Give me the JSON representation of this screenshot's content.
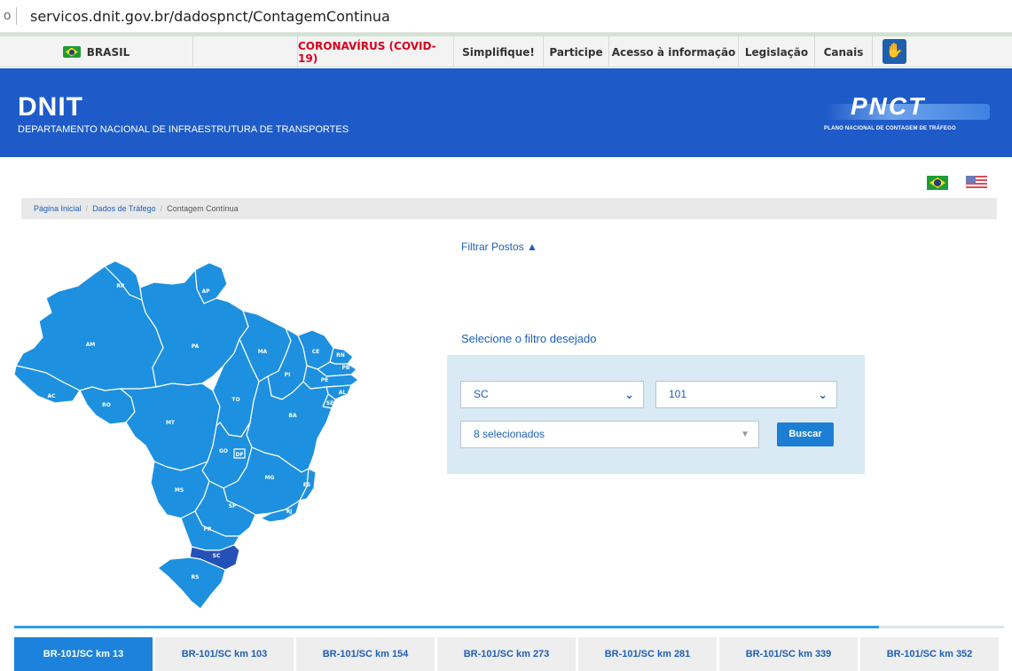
{
  "browser": {
    "fragment": "o",
    "url": "servicos.dnit.gov.br/dadospnct/ContagemContinua"
  },
  "govbar": {
    "brasil": "BRASIL",
    "items": [
      "CORONAVÍRUS (COVID-19)",
      "Simplifique!",
      "Participe",
      "Acesso à informação",
      "Legislação",
      "Canais"
    ],
    "highlight_color": "#d8001b"
  },
  "header": {
    "title": "DNIT",
    "subtitle": "DEPARTAMENTO NACIONAL DE INFRAESTRUTURA DE TRANSPORTES",
    "logo": "PNCT",
    "logo_subtitle": "PLANO NACIONAL DE CONTAGEM DE TRÁFEGO",
    "bg_color": "#1e5bc8"
  },
  "breadcrumb": {
    "home": "Página Inicial",
    "section": "Dados de Tráfego",
    "current": "Contagem Contínua"
  },
  "map": {
    "states": [
      "RR",
      "AP",
      "AM",
      "PA",
      "MA",
      "CE",
      "RN",
      "PB",
      "PE",
      "AL",
      "SE",
      "PI",
      "AC",
      "RO",
      "TO",
      "BA",
      "MT",
      "DF",
      "GO",
      "MG",
      "ES",
      "MS",
      "SP",
      "RJ",
      "PR",
      "SC",
      "RS"
    ],
    "selected_state": "SC",
    "fill_color": "#1e90e0",
    "selected_color": "#2451b8"
  },
  "filters": {
    "toggle_label": "Filtrar Postos ▲",
    "heading": "Selecione o filtro desejado",
    "uf_value": "SC",
    "br_value": "101",
    "postos_value": "8 selecionados",
    "search_label": "Buscar"
  },
  "tabs": [
    {
      "label": "BR-101/SC km 13",
      "active": true
    },
    {
      "label": "BR-101/SC km 103",
      "active": false
    },
    {
      "label": "BR-101/SC km 154",
      "active": false
    },
    {
      "label": "BR-101/SC km 273",
      "active": false
    },
    {
      "label": "BR-101/SC km 281",
      "active": false
    },
    {
      "label": "BR-101/SC km 339",
      "active": false
    },
    {
      "label": "BR-101/SC km 352",
      "active": false
    }
  ]
}
